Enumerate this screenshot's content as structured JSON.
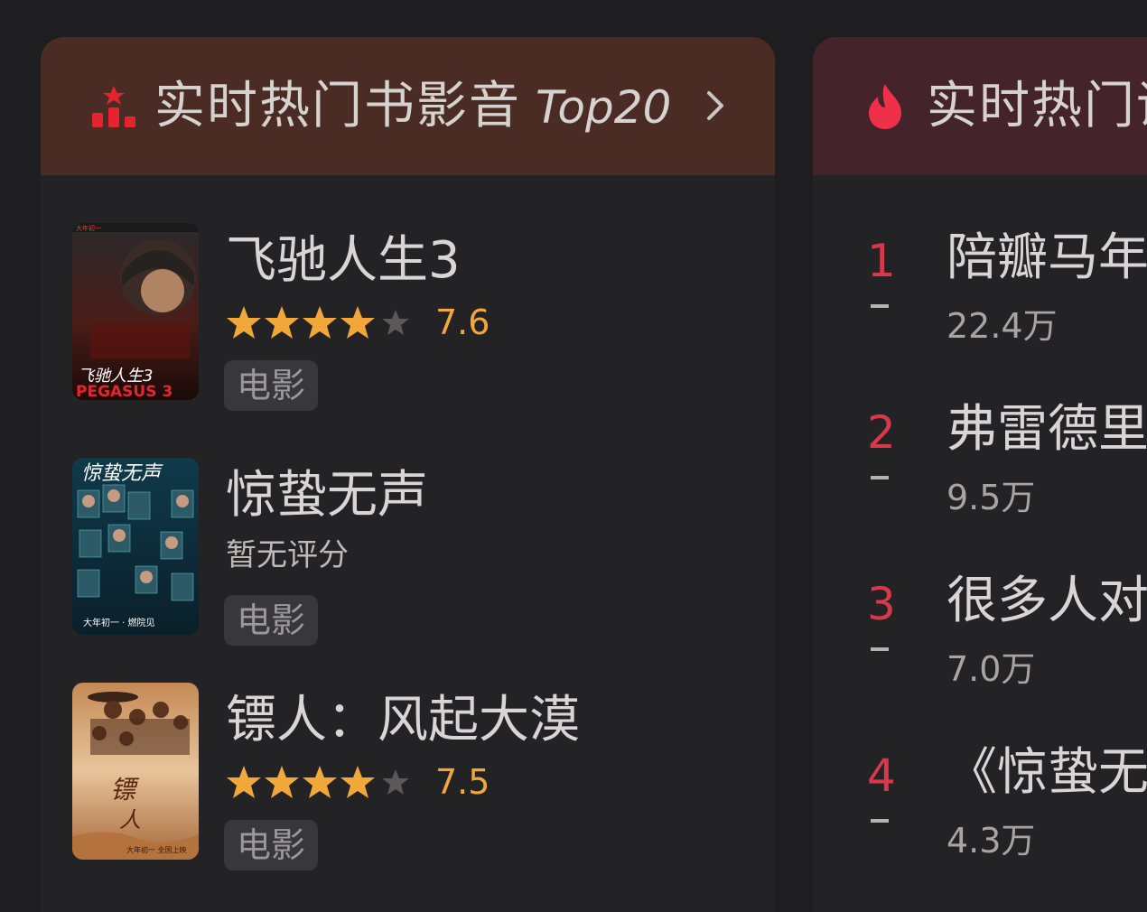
{
  "colors": {
    "background": "#1e1e20",
    "left_header": "#4a2c24",
    "right_header": "#45232b",
    "star_filled": "#f2a73b",
    "star_empty": "#5a5858",
    "rank_red": "#d8394a"
  },
  "left_panel": {
    "title": "实时热门书影音",
    "title_suffix": "Top20",
    "header_icon": "ranking-chart-icon",
    "more_icon": "chevron-right-icon",
    "items": [
      {
        "title": "飞驰人生3",
        "rating": 7.6,
        "rating_text": "7.6",
        "stars_filled": 4,
        "stars_total": 5,
        "tag": "电影",
        "poster_text": "飞驰人生3 PEGASUS 3"
      },
      {
        "title": "惊蛰无声",
        "rating_text": "暂无评分",
        "tag": "电影",
        "poster_text": "惊蛰无声"
      },
      {
        "title": "镖人：风起大漠",
        "rating": 7.5,
        "rating_text": "7.5",
        "stars_filled": 4,
        "stars_total": 5,
        "tag": "电影",
        "poster_text": "镖人"
      }
    ]
  },
  "right_panel": {
    "title": "实时热门话",
    "header_icon": "flame-icon",
    "items": [
      {
        "rank": "1",
        "title": "陪瓣马年",
        "count": "22.4万"
      },
      {
        "rank": "2",
        "title": "弗雷德里",
        "count": "9.5万"
      },
      {
        "rank": "3",
        "title": "很多人对",
        "count": "7.0万"
      },
      {
        "rank": "4",
        "title": "《惊蛰无声",
        "count": "4.3万"
      }
    ]
  }
}
